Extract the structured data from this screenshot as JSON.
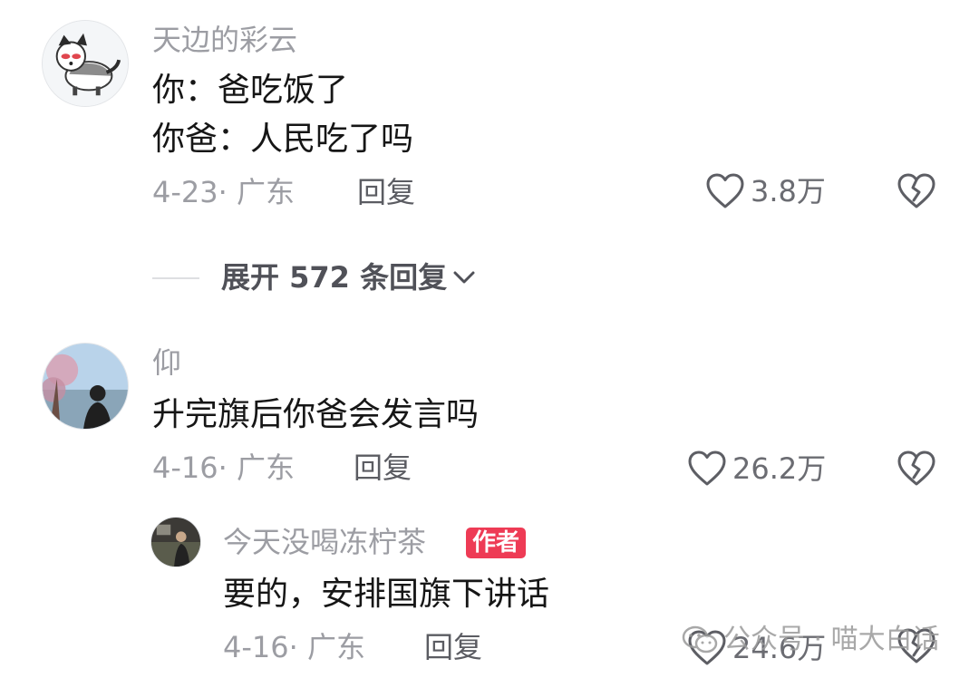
{
  "comments": [
    {
      "username": "天边的彩云",
      "lines": [
        "你：爸吃饭了",
        "你爸：人民吃了吗"
      ],
      "date_location": "4-23· 广东",
      "reply_label": "回复",
      "likes": "3.8万"
    },
    {
      "username": "仰",
      "lines": [
        "升完旗后你爸会发言吗"
      ],
      "date_location": "4-16· 广东",
      "reply_label": "回复",
      "likes": "26.2万"
    }
  ],
  "expand_replies": {
    "label": "展开 572 条回复"
  },
  "sub_reply": {
    "username": "今天没喝冻柠茶",
    "badge": "作者",
    "lines": [
      "要的，安排国旗下讲话"
    ],
    "date_location": "4-16· 广东",
    "reply_label": "回复",
    "likes": "24.6万"
  },
  "watermark": {
    "text": "公众号 · 喵大白话"
  },
  "colors": {
    "author_badge": "#ee3b55",
    "meta_text": "#9c9da3",
    "content_text": "#161616"
  },
  "icons": {
    "like": "heart-outline-icon",
    "dislike": "broken-heart-icon",
    "expand": "chevron-down-icon",
    "watermark": "wechat-icon"
  }
}
